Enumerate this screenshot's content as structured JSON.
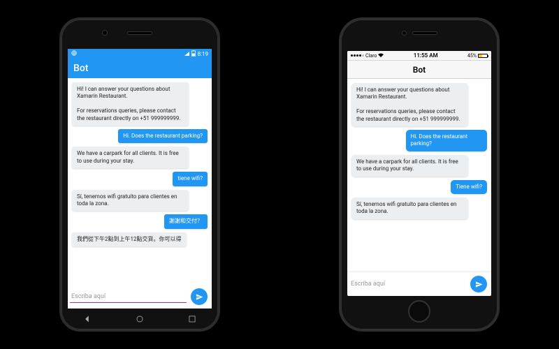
{
  "android": {
    "status": {
      "time": "8:19",
      "battery_icon": "battery-half",
      "signal_icon": "signal"
    },
    "header": {
      "title": "Bot"
    },
    "messages": [
      {
        "role": "bot",
        "text": "Hi! I can answer your questions about Xamarin Restaurant.\n\nFor reservations queries, please contact the restaurant directly on +51 999999999."
      },
      {
        "role": "user",
        "text": "Hi. Does the restaurant parking?"
      },
      {
        "role": "bot",
        "text": "We have a carpark for all clients. It is free to use during your stay."
      },
      {
        "role": "user",
        "text": "tiene wifi?"
      },
      {
        "role": "bot",
        "text": "Sí, tenemos wifi gratuito para clientes en toda la zona."
      },
      {
        "role": "user",
        "text": "謝謝和交付？"
      },
      {
        "role": "bot",
        "text": "我們從下午2點到上午12點交貨。你可以得"
      }
    ],
    "input": {
      "placeholder": "Escriba aquí",
      "send_label": "send"
    }
  },
  "ios": {
    "status": {
      "carrier": "Claro",
      "time": "11:55 AM",
      "battery": "45%"
    },
    "header": {
      "title": "Bot"
    },
    "messages": [
      {
        "role": "bot",
        "text": "Hi! I can answer your questions about Xamarin Restaurant.\n\nFor reservations queries, please contact the restaurant directly on +51 999999999."
      },
      {
        "role": "user",
        "text": "Hi. Does the restaurant parking?"
      },
      {
        "role": "bot",
        "text": "We have a carpark for all clients. It is free to use during your stay."
      },
      {
        "role": "user",
        "text": "Tiene wifi?"
      },
      {
        "role": "bot",
        "text": "Sí, tenemos wifi gratuito para clientes en toda la zona."
      }
    ],
    "input": {
      "placeholder": "Escriba aquí",
      "send_label": "send"
    }
  },
  "colors": {
    "primary": "#2196F3",
    "bot_bubble": "#eceff1",
    "accent_android": "#e91e63"
  }
}
